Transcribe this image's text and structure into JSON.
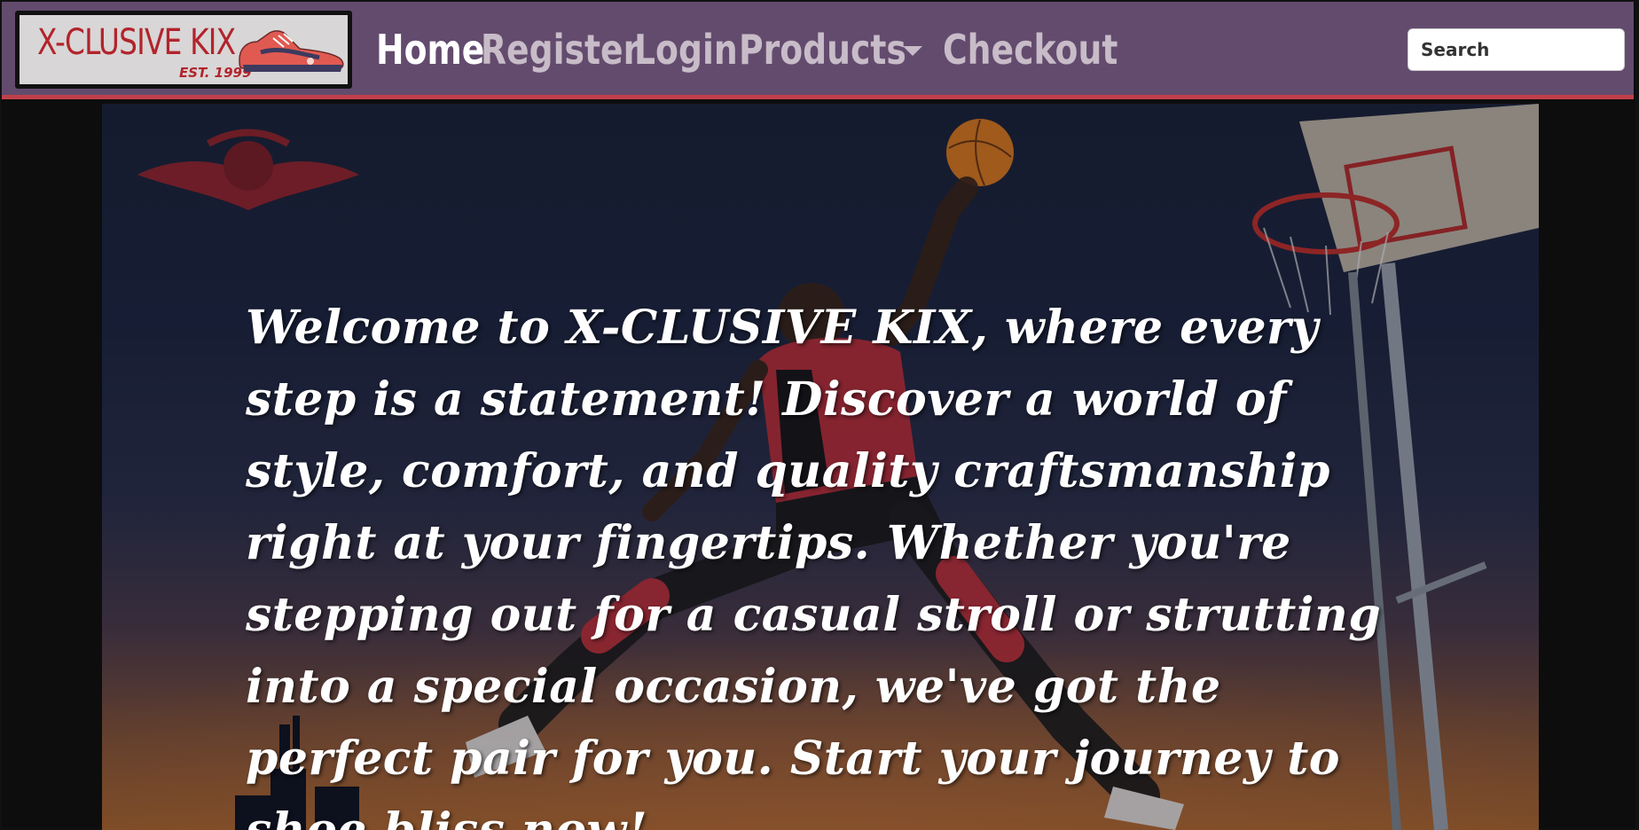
{
  "brand": {
    "name": "X-CLUSIVE KIX",
    "est": "EST. 1999",
    "logo_icon": "sneaker-icon"
  },
  "nav": {
    "items": [
      {
        "label": "Home",
        "active": true
      },
      {
        "label": "Register",
        "active": false
      },
      {
        "label": "Login",
        "active": false
      },
      {
        "label": "Products",
        "active": false,
        "dropdown": true
      },
      {
        "label": "Checkout",
        "active": false
      }
    ]
  },
  "search": {
    "placeholder": "Search",
    "value": ""
  },
  "hero": {
    "welcome_text": "Welcome to X-CLUSIVE KIX, where every step is a statement! Discover a world of style, comfort, and quality craftsmanship right at your fingertips. Whether you're stepping out for a casual stroll or strutting into a special occasion, we've got the perfect pair for you. Start your journey to shoe bliss now!",
    "background_icon": "basketball-dunk-image"
  },
  "colors": {
    "navbar": "#634b6e",
    "navbar_border": "#c0404a",
    "logo_text": "#b2242c",
    "nav_active": "#ffffff",
    "nav_inactive": "#c8bcc8"
  }
}
